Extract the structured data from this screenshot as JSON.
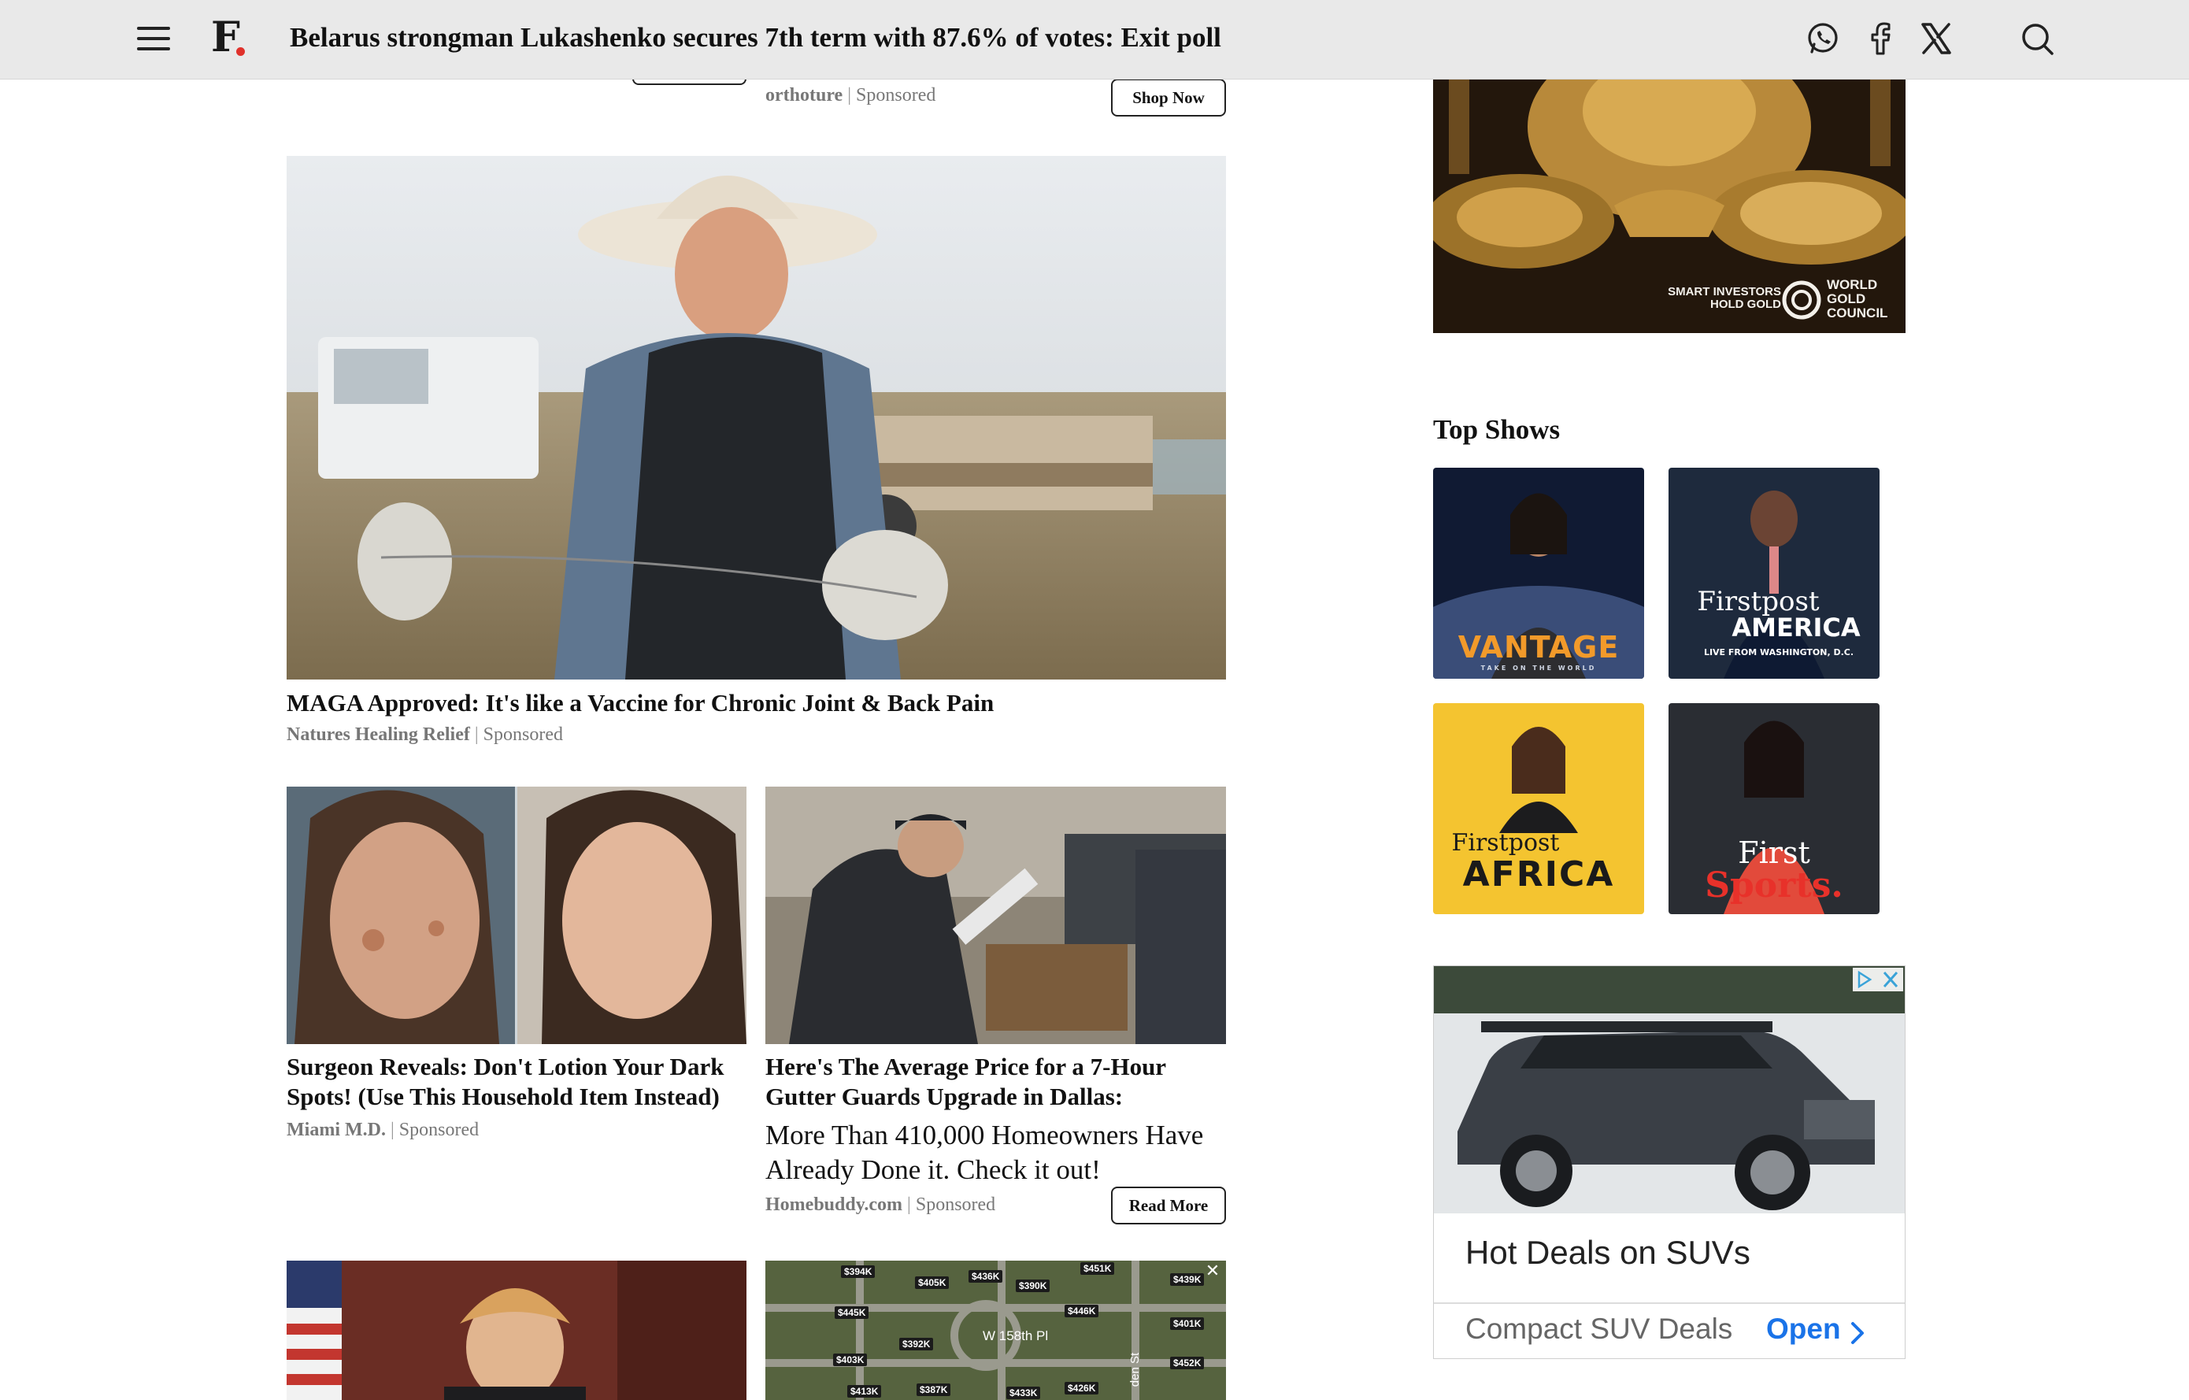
{
  "header": {
    "logo_text": "F",
    "headline": "Belarus strongman Lukashenko secures 7th term with 87.6% of votes: Exit poll"
  },
  "ads": {
    "top_right": {
      "source": "orthoture",
      "sponsored": "Sponsored",
      "button": "Shop Now"
    },
    "farmer": {
      "title": "MAGA Approved: It's like a Vaccine for Chronic Joint & Back Pain",
      "source": "Natures Healing Relief",
      "sponsored": "Sponsored"
    },
    "surgeon": {
      "title_line1": "Surgeon Reveals: Don't Lotion Your Dark",
      "title_line2": "Spots! (Use This Household Item Instead)",
      "source": "Miami M.D.",
      "sponsored": "Sponsored"
    },
    "gutter": {
      "title_line1": "Here's The Average Price for a 7-Hour",
      "title_line2": "Gutter Guards Upgrade in Dallas:",
      "desc_line1": "More Than 410,000 Homeowners Have",
      "desc_line2": "Already Done it. Check it out!",
      "source": "Homebuddy.com",
      "sponsored": "Sponsored",
      "button": "Read More"
    },
    "map_prices": [
      "$394K",
      "$405K",
      "$436K",
      "$390K",
      "$439K",
      "$445K",
      "$446K",
      "$401K",
      "$392K",
      "$403K",
      "$452K",
      "$413K",
      "$387K",
      "$433K",
      "$426K",
      "$451K"
    ],
    "map_street": "W 158th Pl",
    "map_street_2": "den St"
  },
  "sidebar": {
    "gold_ad": {
      "tagline_line1": "SMART INVESTORS",
      "tagline_line2": "HOLD GOLD",
      "brand_line1": "WORLD",
      "brand_line2": "GOLD",
      "brand_line3": "COUNCIL"
    },
    "top_shows_title": "Top Shows",
    "shows": [
      {
        "name": "VANTAGE",
        "tagline": "TAKE ON THE WORLD"
      },
      {
        "name_line1": "Firstpost",
        "name_line2": "AMERICA",
        "tagline": "LIVE FROM WASHINGTON, D.C."
      },
      {
        "name_line1": "Firstpost",
        "name_line2": "AFRICA"
      },
      {
        "name_line1": "First",
        "name_line2": "Sports."
      }
    ],
    "suv_ad": {
      "title": "Hot Deals on SUVs",
      "subtitle": "Compact SUV Deals",
      "cta": "Open"
    }
  },
  "colors": {
    "topbar_bg": "#e9e9e9",
    "logo_dot": "#e0312b",
    "open_blue": "#1a73e8",
    "vantage_orange": "#f29a2a",
    "africa_yellow": "#f4c430",
    "sports_red": "#e8312a"
  }
}
